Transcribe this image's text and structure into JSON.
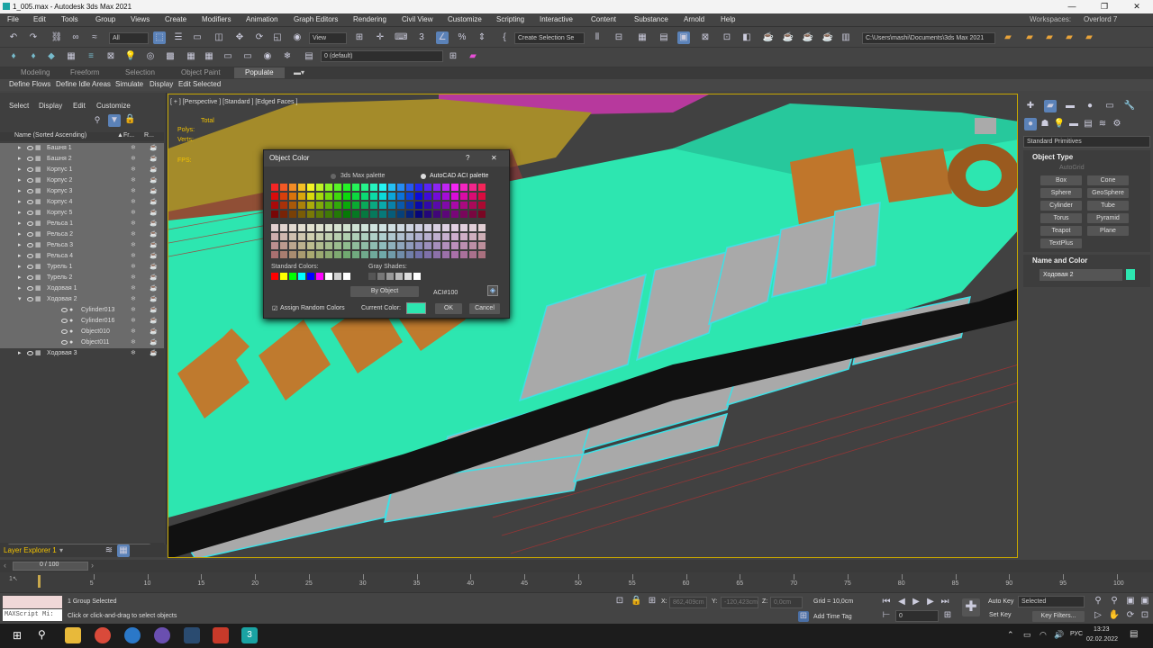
{
  "window": {
    "title": "1_005.max - Autodesk 3ds Max 2021",
    "minimize": "—",
    "maximize": "❐",
    "close": "✕"
  },
  "menu": [
    "File",
    "Edit",
    "Tools",
    "Group",
    "Views",
    "Create",
    "Modifiers",
    "Animation",
    "Graph Editors",
    "Rendering",
    "Civil View",
    "Customize",
    "Scripting",
    "Interactive",
    "Content",
    "Substance",
    "Arnold",
    "Help"
  ],
  "workspaces": {
    "label": "Workspaces:",
    "value": "Overlord 7"
  },
  "toolbar": {
    "filter": "All",
    "refcoord": "View",
    "selset": "Create Selection Se",
    "layer": "0 (default)",
    "path": "C:\\Users\\mashi\\Documents\\3ds Max 2021"
  },
  "ribbon_tabs": [
    "Modeling",
    "Freeform",
    "Selection",
    "Object Paint",
    "Populate"
  ],
  "ribbon_items": [
    "Define Flows",
    "Define Idle Areas",
    "Simulate",
    "Display",
    "Edit Selected"
  ],
  "scene_explorer": {
    "menu": [
      "Select",
      "Display",
      "Edit",
      "Customize"
    ],
    "col_name": "Name (Sorted Ascending)",
    "col_fr": "Fr...",
    "col_r": "R...",
    "rows": [
      {
        "name": "Башня 1",
        "sel": true,
        "child": false
      },
      {
        "name": "Башня 2",
        "sel": true,
        "child": false
      },
      {
        "name": "Корпус 1",
        "sel": true,
        "child": false
      },
      {
        "name": "Корпус 2",
        "sel": true,
        "child": false
      },
      {
        "name": "Корпус 3",
        "sel": true,
        "child": false
      },
      {
        "name": "Корпус 4",
        "sel": true,
        "child": false
      },
      {
        "name": "Корпус 5",
        "sel": true,
        "child": false
      },
      {
        "name": "Рельса 1",
        "sel": true,
        "child": false
      },
      {
        "name": "Рельса 2",
        "sel": true,
        "child": false
      },
      {
        "name": "Рельса 3",
        "sel": true,
        "child": false
      },
      {
        "name": "Рельса 4",
        "sel": true,
        "child": false
      },
      {
        "name": "Турель 1",
        "sel": true,
        "child": false
      },
      {
        "name": "Турель 2",
        "sel": true,
        "child": false
      },
      {
        "name": "Ходовая 1",
        "sel": true,
        "child": false
      },
      {
        "name": "Ходовая 2",
        "sel": true,
        "child": false
      },
      {
        "name": "Cylinder013",
        "sel": true,
        "child": true
      },
      {
        "name": "Cylinder016",
        "sel": true,
        "child": true
      },
      {
        "name": "Object010",
        "sel": true,
        "child": true
      },
      {
        "name": "Object011",
        "sel": true,
        "child": true
      },
      {
        "name": "Ходовая 3",
        "sel": false,
        "child": false
      }
    ],
    "layer_explorer": "Layer Explorer 1"
  },
  "viewport": {
    "label": "[ + ] [Perspective ] [Standard ] [Edged Faces ]",
    "stats_total": "Total",
    "stats_polys": "Polys:",
    "stats_verts": "Verts:",
    "stats_fps": "FPS:"
  },
  "dialog": {
    "title": "Object Color",
    "help": "?",
    "close": "✕",
    "palette1": "3ds Max palette",
    "palette2": "AutoCAD ACI palette",
    "standard_colors": "Standard Colors:",
    "gray_shades": "Gray Shades:",
    "by_object": "By Object",
    "aci": "ACI#100",
    "assign_random": "Assign Random Colors",
    "current_color": "Current Color:",
    "ok": "OK",
    "cancel": "Cancel",
    "current_hex": "#2de6b0"
  },
  "command_panel": {
    "dropdown": "Standard Primitives",
    "object_type": "Object Type",
    "autogrid": "AutoGrid",
    "buttons": [
      "Box",
      "Cone",
      "Sphere",
      "GeoSphere",
      "Cylinder",
      "Tube",
      "Torus",
      "Pyramid",
      "Teapot",
      "Plane",
      "TextPlus"
    ],
    "name_color": "Name and Color",
    "object_name": "Ходовая 2",
    "object_color": "#2de6b0"
  },
  "timeline": {
    "frame": "0 / 100",
    "ticks": [
      "5",
      "10",
      "15",
      "20",
      "25",
      "30",
      "35",
      "40",
      "45",
      "50",
      "55",
      "60",
      "65",
      "70",
      "75",
      "80",
      "85",
      "90",
      "95",
      "100"
    ]
  },
  "status": {
    "maxscript": "MAXScript Mi:",
    "selected": "1 Group Selected",
    "hint": "Click or click-and-drag to select objects",
    "x_label": "X:",
    "x_val": "862,409cm",
    "y_label": "Y:",
    "y_val": "-120,423cm",
    "z_label": "Z:",
    "z_val": "0,0cm",
    "grid": "Grid = 10,0cm",
    "add_time_tag": "Add Time Tag",
    "auto_key": "Auto Key",
    "set_key": "Set Key",
    "selected_dd": "Selected",
    "key_filters": "Key Filters...",
    "frame_field": "0"
  },
  "taskbar": {
    "lang": "РУС",
    "time": "13:23",
    "date": "02.02.2022"
  }
}
